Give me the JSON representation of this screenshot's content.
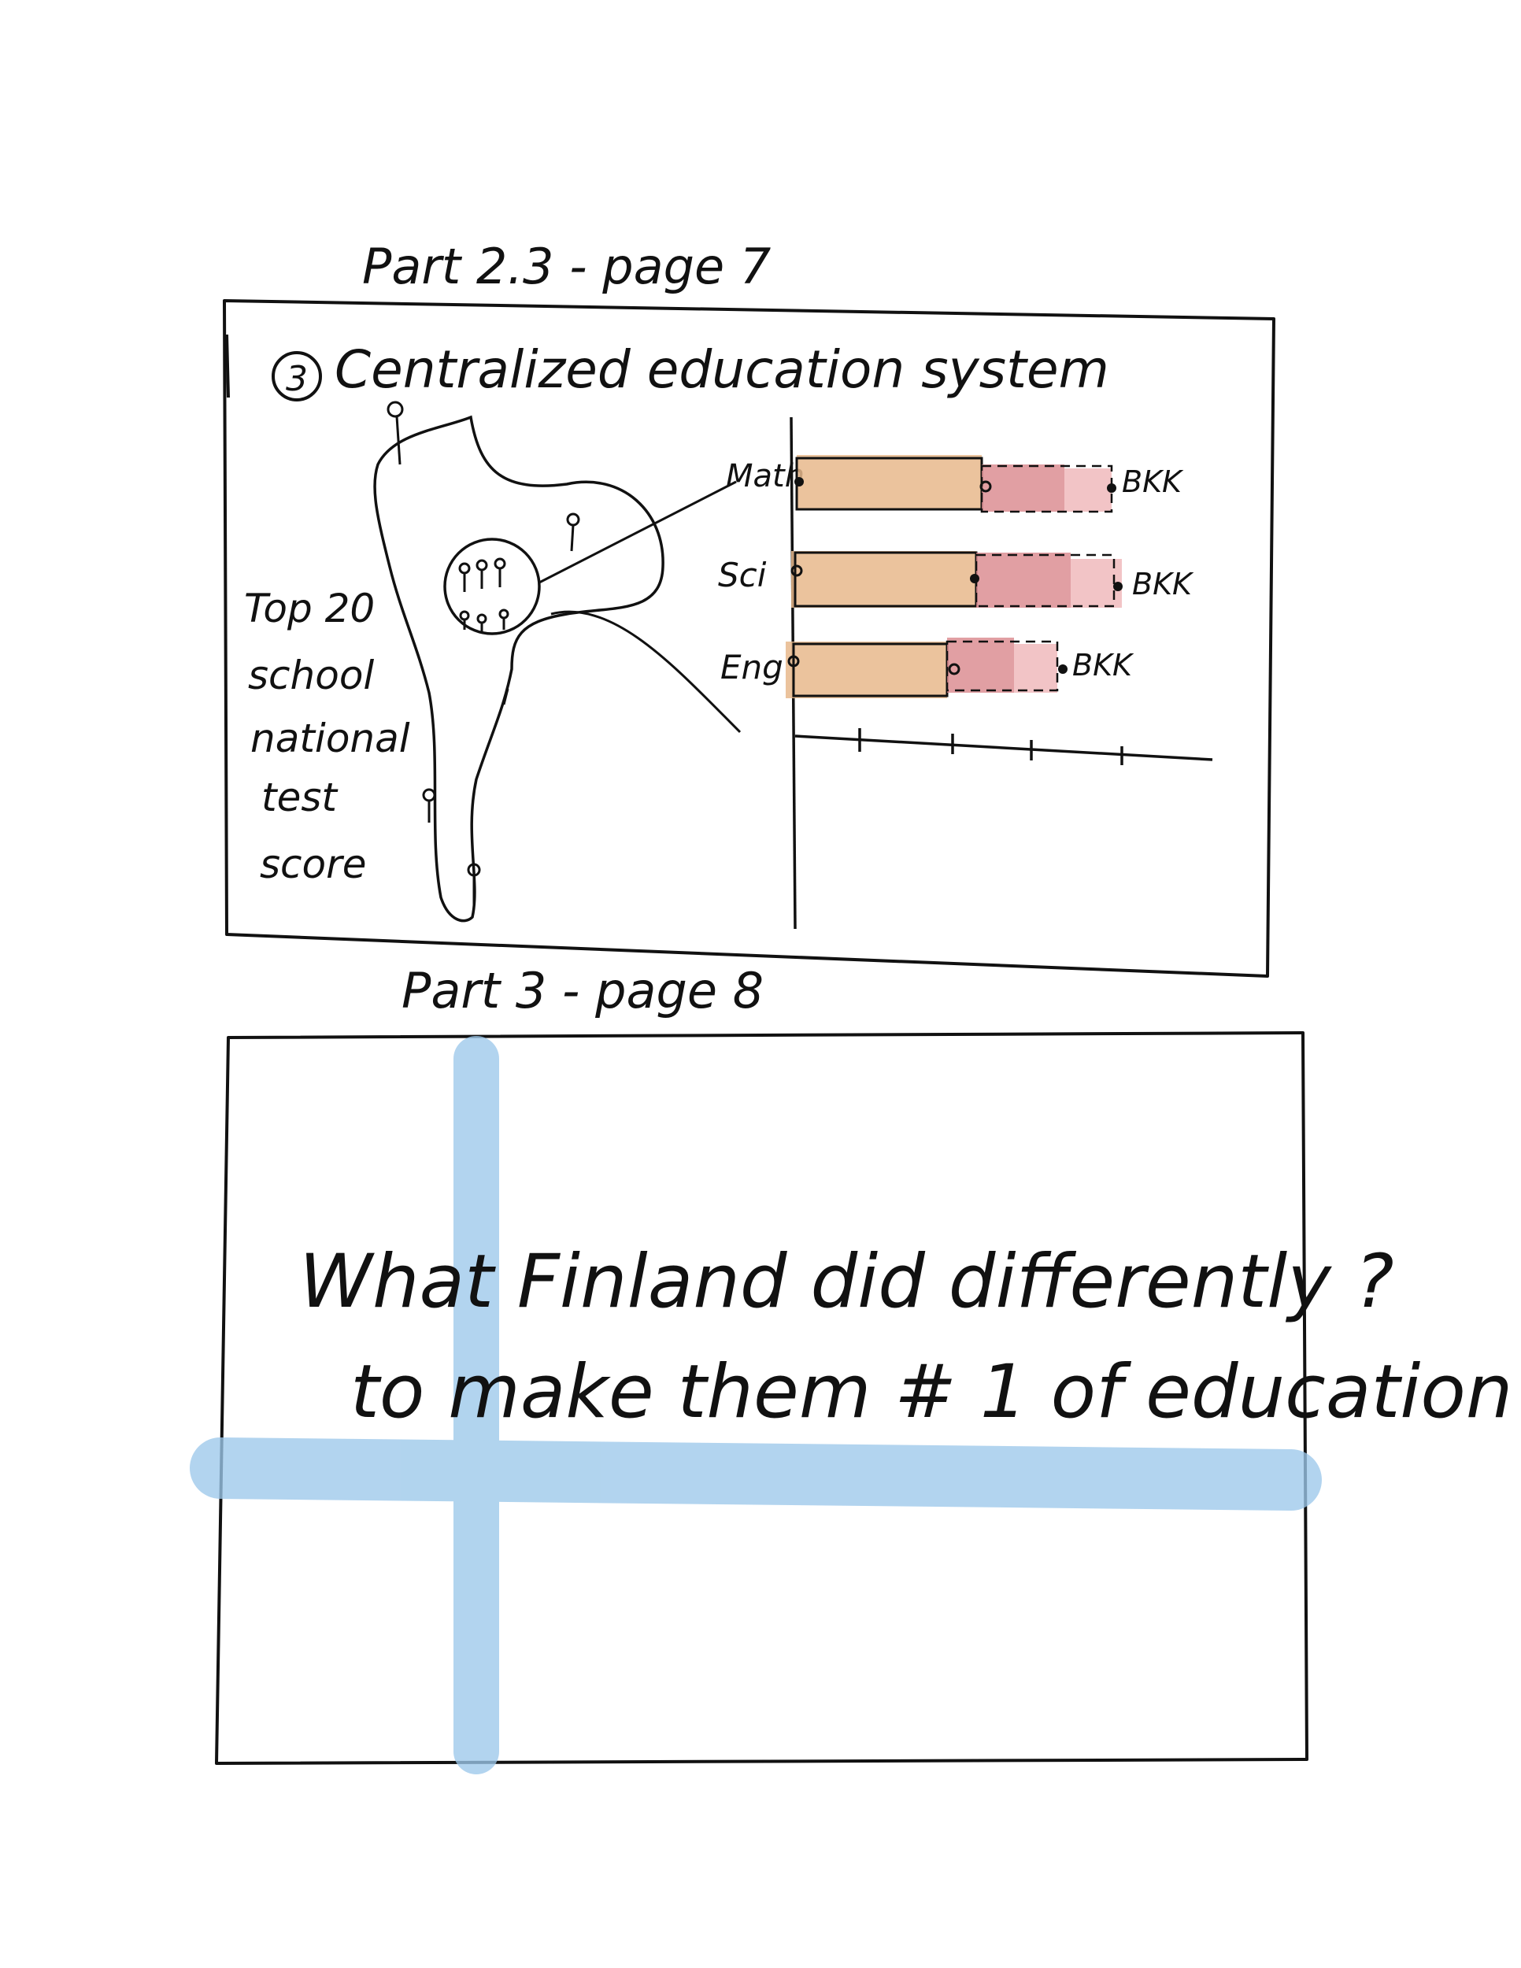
{
  "storyboard": {
    "panel1": {
      "heading": "Part 2.3 - page 7",
      "number": "3",
      "title": "Centralized education system",
      "side_label": [
        "Top 20",
        "school",
        "national",
        "test",
        "score"
      ],
      "chart": {
        "rows": [
          {
            "label": "Math",
            "end_label": "BKK"
          },
          {
            "label": "Sci",
            "end_label": "BKK"
          },
          {
            "label": "Eng",
            "end_label": "BKK"
          }
        ]
      }
    },
    "panel2": {
      "heading": "Part 3 - page 8",
      "question_line1": "What Finland did differently ?",
      "question_line2": "to make them # 1 of education"
    }
  },
  "colors": {
    "ink": "#111111",
    "bar_tan": "#e8b88c",
    "bar_rose": "#d9878c",
    "bar_pink": "#efb5b8",
    "flag_blue": "#9cc8ea"
  }
}
